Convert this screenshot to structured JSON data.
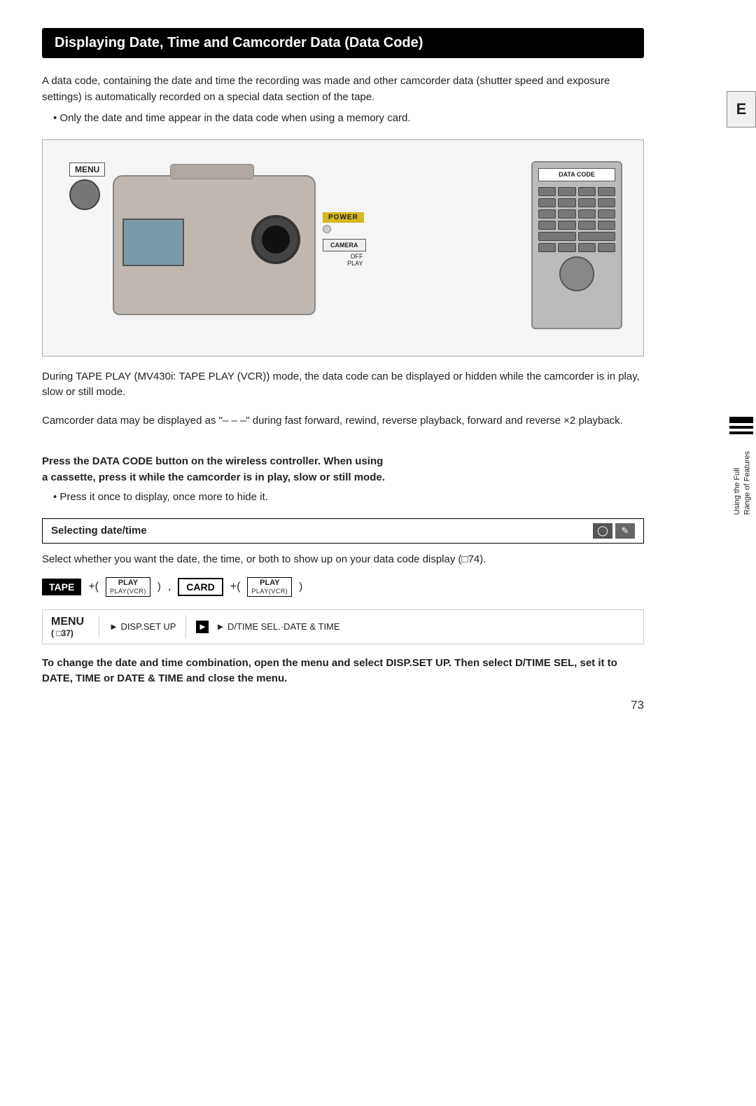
{
  "page": {
    "title": "Displaying Date, Time and Camcorder Data (Data Code)",
    "section_letter": "E",
    "page_number": "73"
  },
  "intro": {
    "para1": "A data code, containing the date and time the recording was made and other camcorder data (shutter speed and exposure settings) is automatically recorded on a special data section of the tape.",
    "bullet1": "Only the date and time appear in the data code when using a memory card.",
    "para2": "During TAPE PLAY (MV430i: TAPE PLAY (VCR)) mode, the data code can be displayed or hidden while the camcorder is in play, slow or still mode.",
    "para3": "Camcorder data may be displayed as \"– – –\" during fast forward, rewind, reverse playback, forward and reverse ×2 playback."
  },
  "instruction": {
    "bold_line1": "Press the DATA CODE button on the wireless controller. When using",
    "bold_line2": "a cassette, press it while the camcorder is in play, slow or still mode.",
    "bullet2": "Press it once to display, once more to hide it."
  },
  "selecting_datetime": {
    "section_title": "Selecting date/time",
    "description": "Select whether you want the date, the time, or both to show up on your data code display (□74).",
    "tape_label": "TAPE",
    "plus1": "+(",
    "play_label": "PLAY",
    "play_vcr": "PLAY(VCR)",
    "comma": ",",
    "card_label": "CARD",
    "plus2": "+(",
    "close_paren": ")"
  },
  "menu_row": {
    "menu_label": "MENU",
    "page_ref": "( □37)",
    "step1_text": "► DISP.SET UP",
    "step2_text": "► D/TIME SEL.·DATE & TIME"
  },
  "final_instruction": {
    "text": "To change the date and time combination, open the menu and select DISP.SET UP. Then select D/TIME SEL, set it to DATE, TIME or DATE & TIME and close the menu."
  },
  "sidebar": {
    "using_text": "Using the Full",
    "range_text": "Range of Features"
  },
  "image": {
    "menu_label": "MENU",
    "power_label": "POWER",
    "camera_label": "CAMERA",
    "off_label": "OFF",
    "play_label": "PLAY",
    "data_code_label": "DATA\nCODE"
  }
}
